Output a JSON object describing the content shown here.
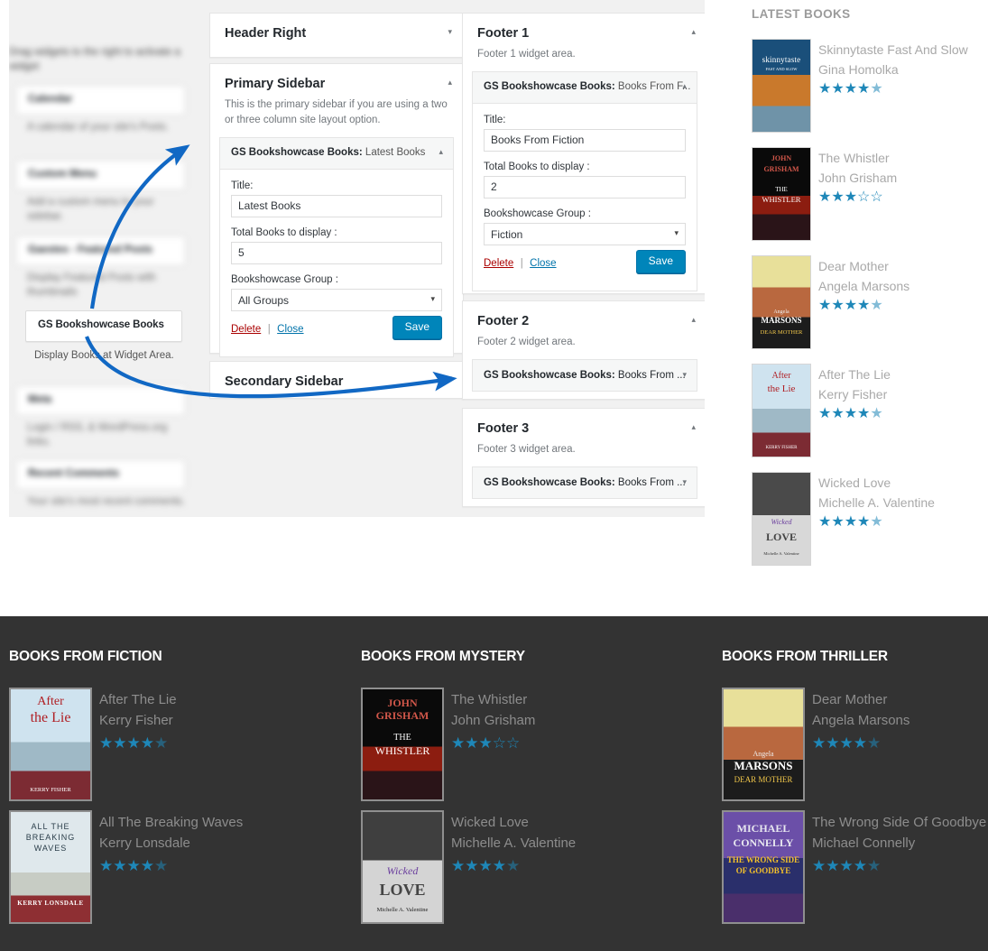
{
  "admin": {
    "available_widgets": {
      "intro": "Drag widgets to the right to activate a widget",
      "items": [
        {
          "name": "Calendar",
          "desc": "A calendar of your site's Posts."
        },
        {
          "name": "Custom Menu",
          "desc": "Add a custom menu to your sidebar."
        },
        {
          "name": "Gaestes - Featured Posts",
          "desc": "Display Featured Posts with thumbnails"
        },
        {
          "name": "Meta",
          "desc": "Login / RSS, & WordPress.org links."
        },
        {
          "name": "Recent Comments",
          "desc": "Your site's most recent comments."
        }
      ],
      "highlighted": {
        "name": "GS Bookshowcase Books",
        "desc": "Display Books at Widget Area."
      }
    },
    "sidebars": {
      "header_right": {
        "title": "Header Right",
        "toggle": "▾"
      },
      "primary": {
        "title": "Primary Sidebar",
        "desc": "This is the primary sidebar if you are using a two or three column site layout option.",
        "toggle": "▴",
        "widget": {
          "plugin": "GS Bookshowcase Books:",
          "instance": "Latest Books",
          "arrow": "▴",
          "title_label": "Title:",
          "title_value": "Latest Books",
          "total_label": "Total Books to display :",
          "total_value": "5",
          "group_label": "Bookshowcase Group :",
          "group_value": "All Groups",
          "group_arrow": "▾",
          "delete": "Delete",
          "sep": "|",
          "close": "Close",
          "save": "Save"
        }
      },
      "secondary": {
        "title": "Secondary Sidebar",
        "toggle": "▾"
      }
    },
    "footers": {
      "footer1": {
        "title": "Footer 1",
        "desc": "Footer 1 widget area.",
        "toggle": "▴",
        "widget": {
          "plugin": "GS Bookshowcase Books:",
          "instance": "Books From F...",
          "arrow": "▴",
          "title_label": "Title:",
          "title_value": "Books From Fiction",
          "total_label": "Total Books to display :",
          "total_value": "2",
          "group_label": "Bookshowcase Group :",
          "group_value": "Fiction",
          "group_arrow": "▾",
          "delete": "Delete",
          "sep": "|",
          "close": "Close",
          "save": "Save"
        }
      },
      "footer2": {
        "title": "Footer 2",
        "desc": "Footer 2 widget area.",
        "toggle": "▴",
        "widget": {
          "plugin": "GS Bookshowcase Books:",
          "instance": "Books From ...",
          "arrow": "▾"
        }
      },
      "footer3": {
        "title": "Footer 3",
        "desc": "Footer 3 widget area.",
        "toggle": "▴",
        "widget": {
          "plugin": "GS Bookshowcase Books:",
          "instance": "Books From ...",
          "arrow": "▾"
        }
      }
    }
  },
  "latest_books": {
    "heading": "LATEST BOOKS",
    "books": [
      {
        "title": "Skinnytaste Fast And Slow",
        "author": "Gina Homolka",
        "stars": "★★★★",
        "half": "★",
        "empty": "",
        "rating": 4.5
      },
      {
        "title": "The Whistler",
        "author": "John Grisham",
        "stars": "★★★",
        "half": "",
        "empty": "☆☆",
        "rating": 3
      },
      {
        "title": "Dear Mother",
        "author": "Angela Marsons",
        "stars": "★★★★",
        "half": "★",
        "empty": "",
        "rating": 4.5
      },
      {
        "title": "After The Lie",
        "author": "Kerry Fisher",
        "stars": "★★★★",
        "half": "★",
        "empty": "",
        "rating": 4.5
      },
      {
        "title": "Wicked Love",
        "author": "Michelle A. Valentine",
        "stars": "★★★★",
        "half": "★",
        "empty": "",
        "rating": 4.5
      }
    ]
  },
  "footer_widgets": [
    {
      "heading": "BOOKS FROM FICTION",
      "books": [
        {
          "title": "After The Lie",
          "author": "Kerry Fisher",
          "stars": "★★★★",
          "half": "★",
          "empty": "",
          "rating": 4.5
        },
        {
          "title": "All The Breaking Waves",
          "author": "Kerry Lonsdale",
          "stars": "★★★★",
          "half": "★",
          "empty": "",
          "rating": 4.5
        }
      ]
    },
    {
      "heading": "BOOKS FROM MYSTERY",
      "books": [
        {
          "title": "The Whistler",
          "author": "John Grisham",
          "stars": "★★★",
          "half": "",
          "empty": "☆☆",
          "rating": 3
        },
        {
          "title": "Wicked Love",
          "author": "Michelle A. Valentine",
          "stars": "★★★★",
          "half": "★",
          "empty": "",
          "rating": 4.5
        }
      ]
    },
    {
      "heading": "BOOKS FROM THRILLER",
      "books": [
        {
          "title": "Dear Mother",
          "author": "Angela Marsons",
          "stars": "★★★★",
          "half": "★",
          "empty": "",
          "rating": 4.5
        },
        {
          "title": "The Wrong Side Of Goodbye",
          "author": "Michael Connelly",
          "stars": "★★★★",
          "half": "★",
          "empty": "",
          "rating": 4.5
        }
      ]
    }
  ],
  "covers": {
    "skinnytaste": {
      "l1": "skinnytaste",
      "l2": "FAST AND SLOW"
    },
    "whistler": {
      "l1": "JOHN",
      "l2": "GRISHAM",
      "l3": "THE",
      "l4": "WHISTLER"
    },
    "dear_mother": {
      "l1": "Angela",
      "l2": "MARSONS",
      "l3": "DEAR MOTHER"
    },
    "after_the_lie": {
      "l1": "After",
      "l2": "the Lie",
      "l3": "KERRY FISHER"
    },
    "wicked_love": {
      "l1": "Wicked",
      "l2": "LOVE",
      "l3": "Michelle A. Valentine"
    },
    "breaking_waves": {
      "l1": "ALL THE BREAKING WAVES",
      "l2": "KERRY LONSDALE"
    },
    "wrong_side": {
      "l1": "MICHAEL",
      "l2": "CONNELLY",
      "l3": "THE WRONG SIDE",
      "l4": "OF GOODBYE"
    }
  },
  "colors": {
    "wp_blue": "#0085ba",
    "star_blue": "#1e87b8",
    "delete_red": "#a00",
    "arrow_blue": "#1168c4",
    "footer_bg": "#333333"
  }
}
